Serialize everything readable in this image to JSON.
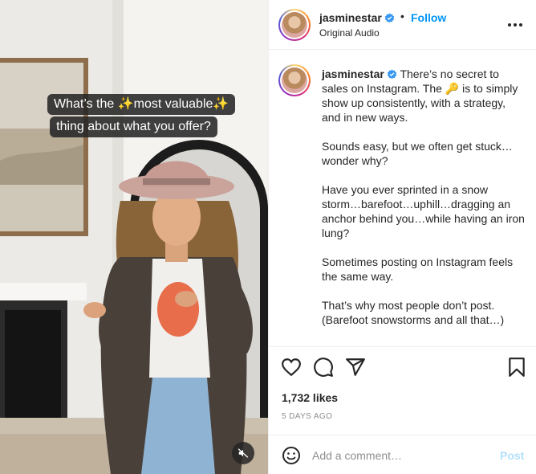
{
  "media": {
    "overlay_lines": [
      {
        "before": "What’s the ",
        "sparkle_left": "✨",
        "mid": "most valuable",
        "sparkle_right": "✨"
      },
      {
        "text": "thing about what you offer?"
      }
    ],
    "mute_icon": "speaker-muted-icon"
  },
  "header": {
    "username": "jasminestar",
    "separator": "•",
    "follow_label": "Follow",
    "audio_label": "Original Audio",
    "verified_color": "#3897f0"
  },
  "caption": {
    "username": "jasminestar",
    "paragraphs": [
      "There’s no secret to sales on Instagram. The 🔑 is to simply show up consistently, with a strategy, and in new ways.",
      "Sounds easy, but we often get stuck…wonder why?",
      "Have you ever sprinted in a snow storm…barefoot…uphill…dragging an anchor behind you…while having an iron lung?",
      "Sometimes posting on Instagram feels the same way.",
      "That’s why most people don’t post. (Barefoot snowstorms and all that…)"
    ]
  },
  "actions": {
    "icons": [
      "heart-icon",
      "comment-icon",
      "share-icon",
      "bookmark-icon"
    ]
  },
  "stats": {
    "likes": "1,732 likes",
    "date": "5 DAYS AGO"
  },
  "comment": {
    "placeholder": "Add a comment…",
    "post_label": "Post"
  },
  "colors": {
    "accent": "#0095f6",
    "post_disabled": "#b2dffc",
    "text": "#262626",
    "muted": "#8e8e8e"
  }
}
